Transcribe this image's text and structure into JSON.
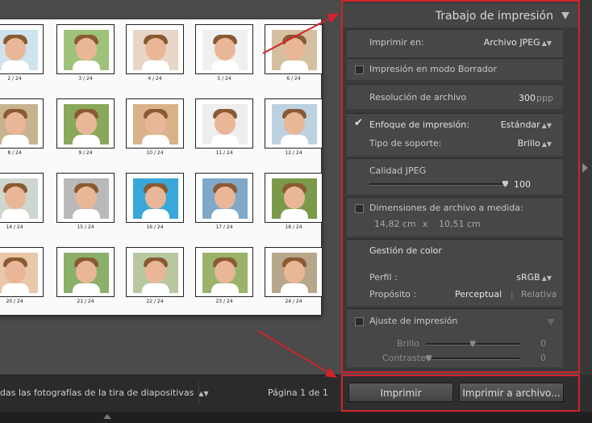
{
  "panel": {
    "title": "Trabajo de impresión",
    "print_to_label": "Imprimir en:",
    "print_to_value": "Archivo JPEG",
    "draft_label": "Impresión en modo Borrador",
    "resolution_label": "Resolución de archivo",
    "resolution_value": "300",
    "resolution_unit": "ppp",
    "sharpen_label": "Enfoque de impresión:",
    "sharpen_value": "Estándar",
    "media_label": "Tipo de soporte:",
    "media_value": "Brillo",
    "jpeg_label": "Calidad JPEG",
    "jpeg_value": "100",
    "jpeg_fraction": 1.0,
    "dims_label": "Dimensiones de archivo a medida:",
    "dims_w": "14,82 cm",
    "dims_x": "x",
    "dims_h": "10,51 cm",
    "color_header": "Gestión de color",
    "profile_label": "Perfil :",
    "profile_value": "sRGB",
    "intent_label": "Propósito :",
    "intent_perceptual": "Perceptual",
    "intent_sep": "|",
    "intent_relative": "Relativa",
    "adjust_label": "Ajuste de impresión",
    "brightness_label": "Brillo",
    "brightness_value": "0",
    "brightness_fraction": 0.5,
    "contrast_label": "Contraste",
    "contrast_value": "0",
    "contrast_fraction": 0.0
  },
  "bottom": {
    "filmstrip_label": "das las fotografías de la tira de diapositivas",
    "page_label": "Página 1 de 1",
    "print_button": "Imprimir",
    "print_to_file_button": "Imprimir a archivo..."
  },
  "contact_sheet": {
    "labels": [
      "2 / 24",
      "3 / 24",
      "4 / 24",
      "5 / 24",
      "6 / 24",
      "8 / 24",
      "9 / 24",
      "10 / 24",
      "11 / 24",
      "12 / 24",
      "14 / 24",
      "15 / 24",
      "16 / 24",
      "17 / 24",
      "18 / 24",
      "20 / 24",
      "21 / 24",
      "22 / 24",
      "23 / 24",
      "24 / 24"
    ]
  }
}
